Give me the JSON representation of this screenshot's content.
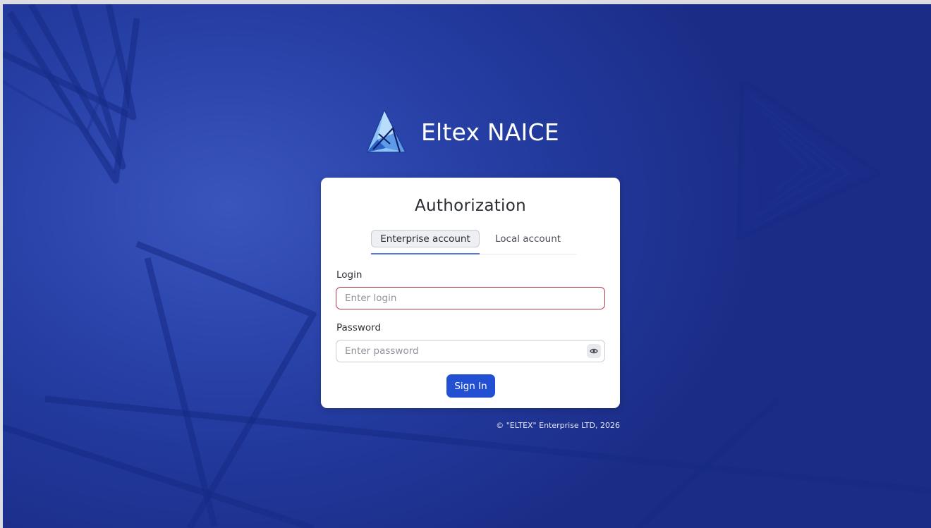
{
  "app": {
    "brand_name": "Eltex NAICE",
    "logo_icon": "eltex-triangle-logo-icon"
  },
  "auth_card": {
    "title": "Authorization",
    "tabs": [
      {
        "label": "Enterprise account",
        "active": true
      },
      {
        "label": "Local account",
        "active": false
      }
    ],
    "login": {
      "label": "Login",
      "value": "",
      "placeholder": "Enter login",
      "state": "invalid"
    },
    "password": {
      "label": "Password",
      "value": "",
      "placeholder": "Enter password",
      "toggle_icon": "eye-icon"
    },
    "submit_label": "Sign In"
  },
  "footer": {
    "copyright": "© \"ELTEX\" Enterprise LTD, 2026"
  },
  "colors": {
    "background": "#2c46ae",
    "card": "#ffffff",
    "primary_button": "#2350d2",
    "error_border": "#b5384d",
    "active_tab_underline": "#5a78d6"
  }
}
